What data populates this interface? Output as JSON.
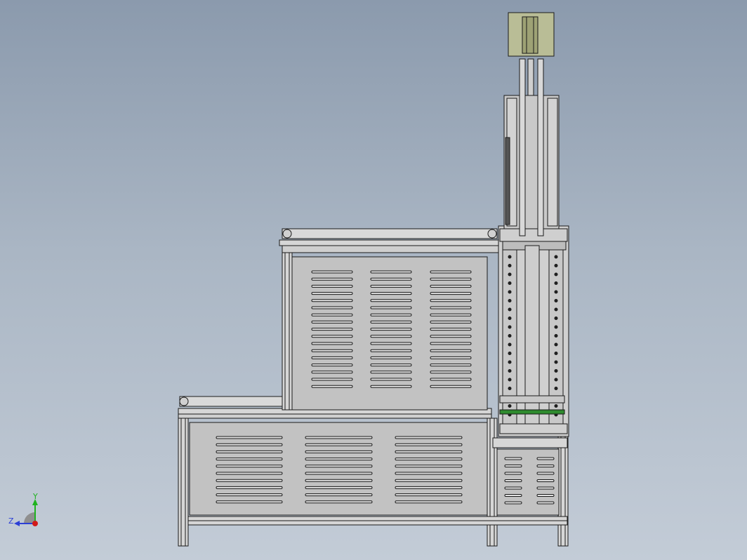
{
  "triad": {
    "x_label": "",
    "y_label": "Y",
    "z_label": "Z",
    "y_color": "#1fb31f",
    "z_color": "#2b3fd6",
    "x_color": "#d11a1a"
  },
  "colors": {
    "panel_fill": "#c2c2c2",
    "frame_fill": "#d6d6d6",
    "line": "#1a1a1a",
    "motor_fill": "#b9bd96",
    "green_part": "#2e8b2e"
  }
}
